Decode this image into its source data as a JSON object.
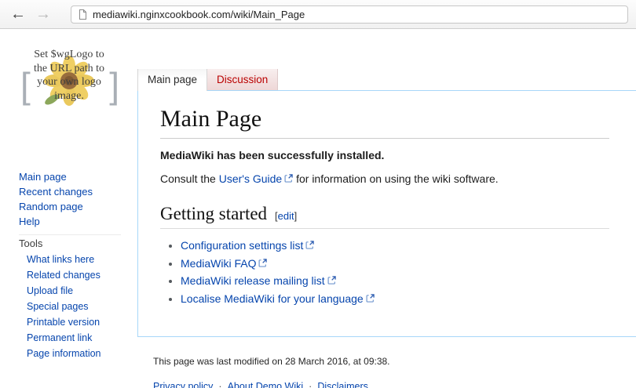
{
  "browser": {
    "url": "mediawiki.nginxcookbook.com/wiki/Main_Page"
  },
  "icons": {
    "back_arrow": "←",
    "forward_arrow": "→"
  },
  "sidebar": {
    "logo": {
      "alt": "Set $wgLogo to the URL path to your own logo image.",
      "bracket_open": "[",
      "bracket_close": "]"
    },
    "nav_items": [
      "Main page",
      "Recent changes",
      "Random page",
      "Help"
    ],
    "tools_header": "Tools",
    "tools_items": [
      "What links here",
      "Related changes",
      "Upload file",
      "Special pages",
      "Printable version",
      "Permanent link",
      "Page information"
    ]
  },
  "tabs": {
    "main": "Main page",
    "discussion": "Discussion"
  },
  "content": {
    "page_title": "Main Page",
    "installed_message": "MediaWiki has been successfully installed.",
    "consult": {
      "prefix": "Consult the ",
      "link": "User's Guide",
      "suffix": " for information on using the wiki software."
    },
    "section": {
      "title": "Getting started",
      "edit_open": "[",
      "edit_label": "edit",
      "edit_close": "]"
    },
    "getting_started_links": [
      "Configuration settings list",
      "MediaWiki FAQ",
      "MediaWiki release mailing list",
      "Localise MediaWiki for your language"
    ]
  },
  "footer": {
    "last_modified": "This page was last modified on 28 March 2016, at 09:38.",
    "separator": "·",
    "links": [
      "Privacy policy",
      "About Demo Wiki",
      "Disclaimers"
    ]
  },
  "colors": {
    "link_blue": "#0645ad",
    "red_link": "#ba0000",
    "content_border": "#a7d7f9"
  }
}
